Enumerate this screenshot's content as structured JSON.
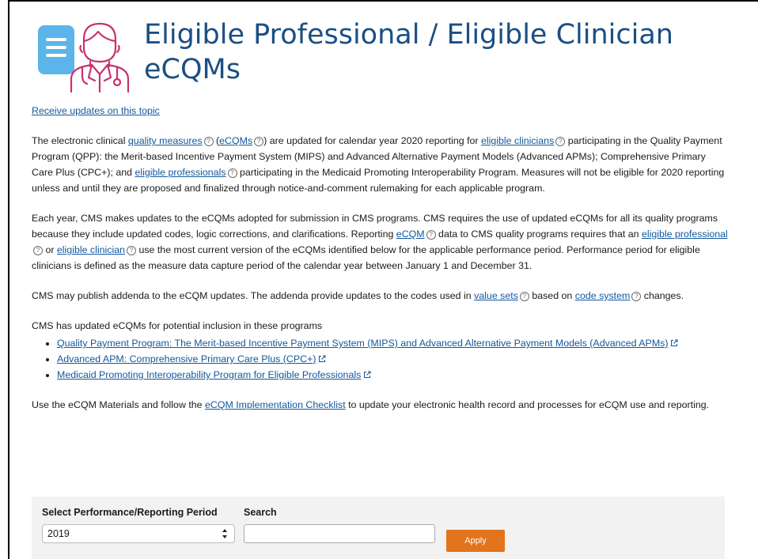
{
  "page": {
    "title_line1": "Eligible Professional / Eligible Clinician",
    "title_line2": "eCQMs",
    "updates_link": "Receive updates on this topic"
  },
  "intro": {
    "t1": "The electronic clinical ",
    "l1": "quality measures",
    "t2": " (",
    "l2": "eCQMs",
    "t3": ") are updated for calendar year 2020 reporting for ",
    "l3": "eligible clinicians",
    "t4": " participating in the Quality Payment Program (QPP): the Merit-based Incentive Payment System (MIPS) and Advanced Alternative Payment Models (Advanced APMs); Comprehensive Primary Care Plus (CPC+); and ",
    "l4": "eligible professionals",
    "t5": " participating in the Medicaid Promoting Interoperability Program. Measures will not be eligible for 2020 reporting unless and until they are proposed and finalized through notice-and-comment rulemaking for each applicable program."
  },
  "para2": {
    "t1": "Each year, CMS makes updates to the eCQMs adopted for submission in CMS programs. CMS requires the use of updated eCQMs for all its quality programs because they include updated codes, logic corrections, and clarifications. Reporting ",
    "l1": "eCQM",
    "t2": " data to CMS quality programs requires that an ",
    "l2": "eligible professional",
    "t3": " or ",
    "l3": "eligible clinician",
    "t4": " use the most current version of the eCQMs identified below for the applicable performance period. Performance period for eligible clinicians is defined as the measure data capture period of the calendar year between January 1 and December 31."
  },
  "para3": {
    "t1": "CMS may publish addenda to the eCQM updates.  The addenda provide updates to the codes used in ",
    "l1": "value sets",
    "t2": " based on ",
    "l2": "code system",
    "t3": " changes."
  },
  "programs": {
    "intro": "CMS has updated eCQMs for potential inclusion in these programs",
    "items": [
      "Quality Payment Program: The Merit-based Incentive Payment System (MIPS) and Advanced Alternative Payment Models (Advanced APMs)",
      "Advanced APM: Comprehensive Primary Care Plus (CPC+)",
      "Medicaid Promoting Interoperability Program for Eligible Professionals"
    ]
  },
  "para5": {
    "t1": "Use the eCQM Materials and follow the ",
    "l1": "eCQM Implementation Checklist",
    "t2": " to update your electronic health record and processes for eCQM use and reporting."
  },
  "filter": {
    "period_label": "Select Performance/Reporting Period",
    "period_value": "2019",
    "search_label": "Search",
    "search_value": "",
    "apply_label": "Apply"
  },
  "colors": {
    "link": "#11589d",
    "title": "#1b4f83",
    "apply": "#e1741c",
    "panel": "#f2f2f2",
    "icon_pink": "#c8336f",
    "icon_blue": "#5bb4ea"
  }
}
